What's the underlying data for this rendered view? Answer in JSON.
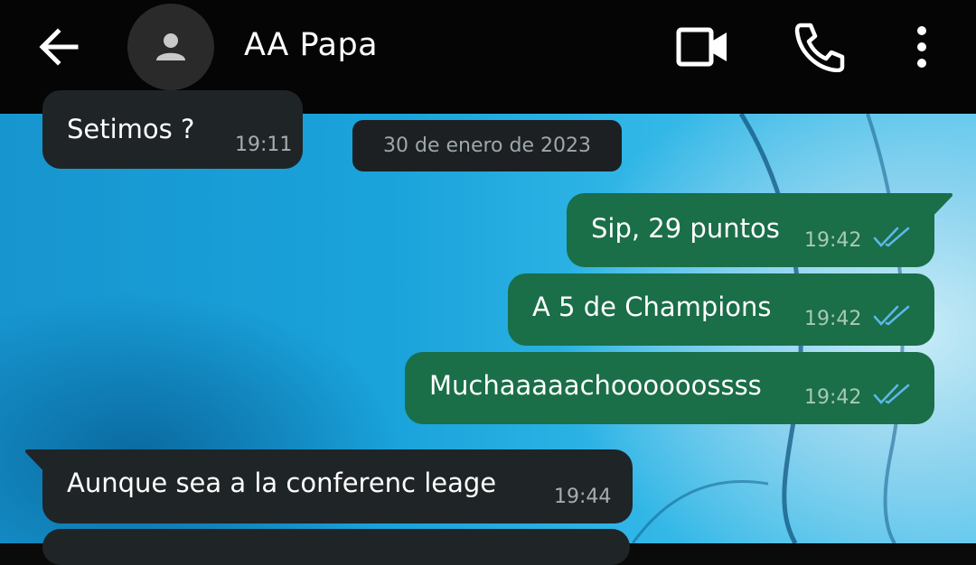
{
  "header": {
    "back_icon": "arrow-left-icon",
    "avatar_icon": "person-icon",
    "contact_name": "AA Papa",
    "video_icon": "video-call-icon",
    "call_icon": "phone-icon",
    "menu_icon": "more-vert-icon"
  },
  "date_divider": "30 de enero de 2023",
  "messages": [
    {
      "direction": "incoming",
      "text": "Setimos ?",
      "time": "19:11"
    },
    {
      "direction": "outgoing",
      "text": "Sip, 29 puntos",
      "time": "19:42",
      "status": "read"
    },
    {
      "direction": "outgoing",
      "text": "A 5 de Champions",
      "time": "19:42",
      "status": "read"
    },
    {
      "direction": "outgoing",
      "text": "Muchaaaaachoooooossss",
      "time": "19:42",
      "status": "read"
    },
    {
      "direction": "incoming",
      "text": "Aunque sea a la conferenc leage",
      "time": "19:44"
    }
  ],
  "colors": {
    "outgoing_bubble": "#1a6e48",
    "incoming_bubble": "#1f2427",
    "read_ticks": "#5bb8e8",
    "header_bg": "#050505"
  }
}
